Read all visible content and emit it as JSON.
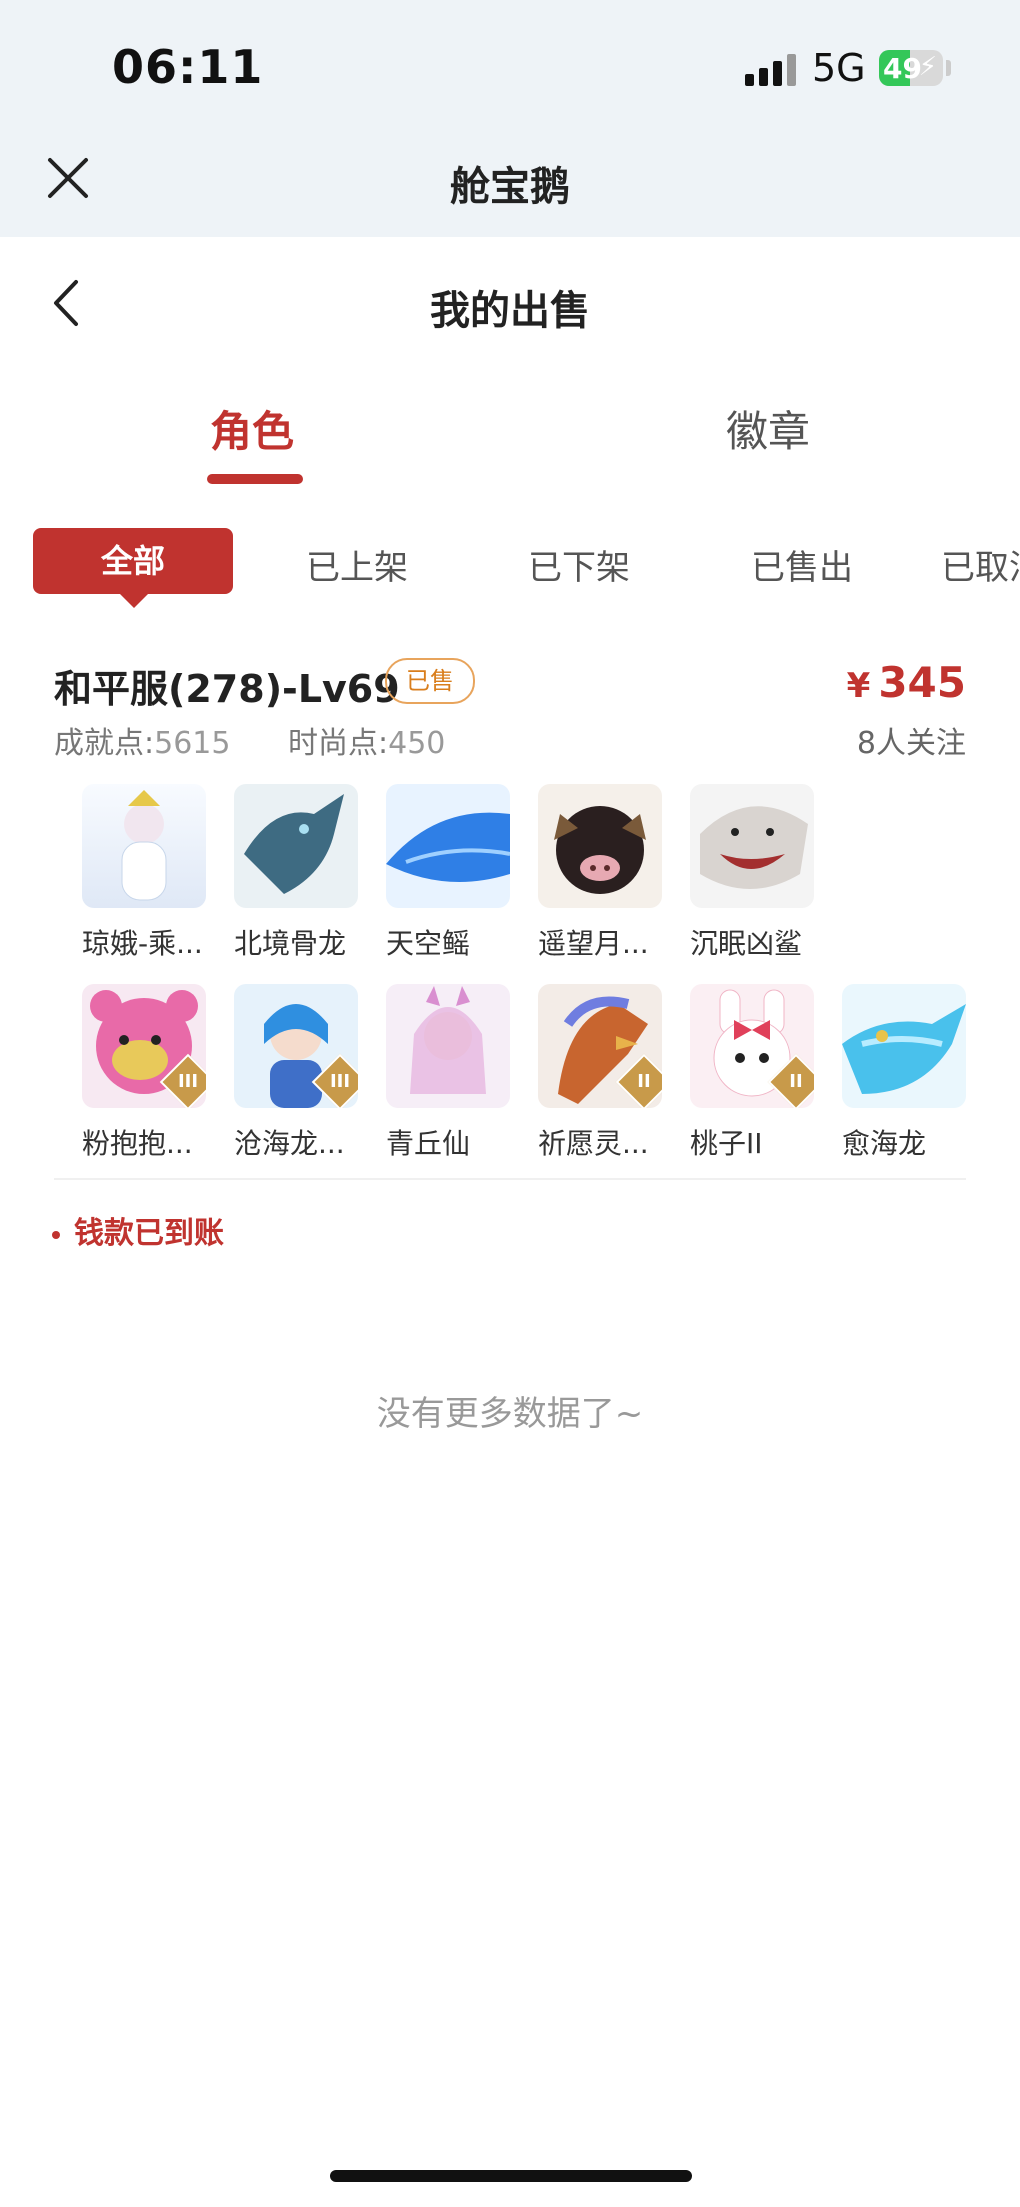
{
  "status_bar": {
    "time": "06:11",
    "network": "5G",
    "battery": "49",
    "battery_fraction": 0.49
  },
  "header": {
    "app_title": "舱宝鹅",
    "page_title": "我的出售"
  },
  "tabs": [
    {
      "label": "角色",
      "active": true
    },
    {
      "label": "徽章",
      "active": false
    }
  ],
  "filters": [
    "全部",
    "已上架",
    "已下架",
    "已售出",
    "已取消"
  ],
  "listing": {
    "server": "和平服(278)-Lv69",
    "status": "已售",
    "price_symbol": "¥",
    "price": "345",
    "followers": "8人关注",
    "achievement_label": "成就点:",
    "achievement_value": "5615",
    "fashion_label": "时尚点:",
    "fashion_value": "450",
    "items": [
      {
        "name": "琼娥-乘...",
        "rank": ""
      },
      {
        "name": "北境骨龙",
        "rank": ""
      },
      {
        "name": "天空鳐",
        "rank": ""
      },
      {
        "name": "遥望月...",
        "rank": ""
      },
      {
        "name": "沉眠凶鲨",
        "rank": ""
      },
      {
        "name": "粉抱抱...",
        "rank": "III"
      },
      {
        "name": "沧海龙...",
        "rank": "III"
      },
      {
        "name": "青丘仙",
        "rank": ""
      },
      {
        "name": "祈愿灵...",
        "rank": "II"
      },
      {
        "name": "桃子II",
        "rank": "II"
      },
      {
        "name": "愈海龙",
        "rank": ""
      }
    ],
    "payment_status": "钱款已到账"
  },
  "footer": {
    "no_more": "没有更多数据了~"
  },
  "colors": {
    "accent": "#c0332f",
    "badge": "#d97e1c",
    "battery": "#34c759"
  }
}
